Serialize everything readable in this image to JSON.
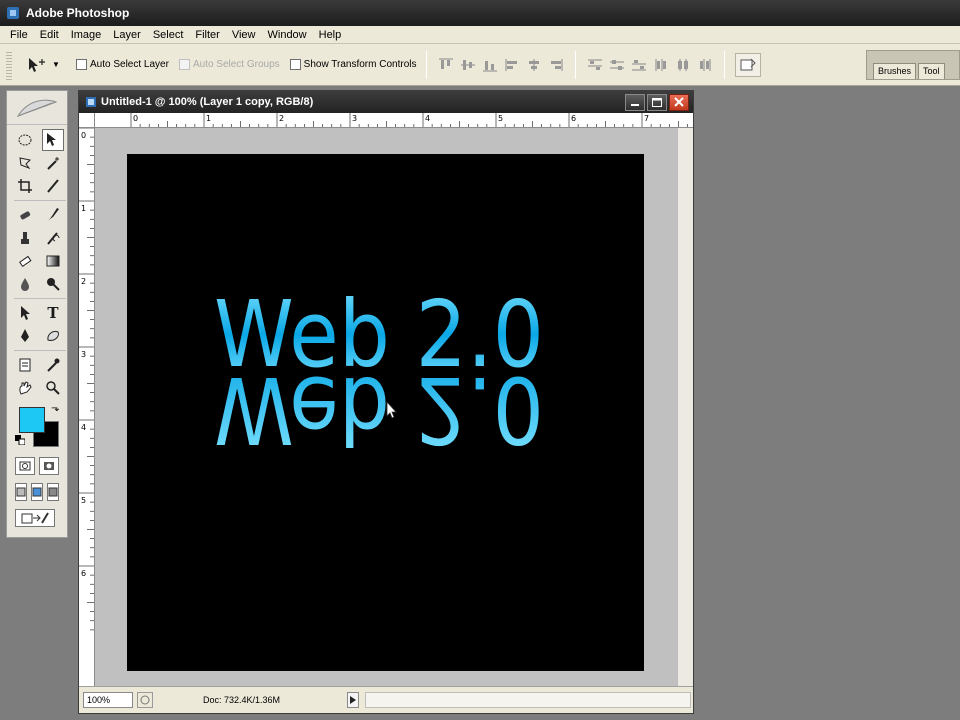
{
  "app": {
    "title": "Adobe Photoshop"
  },
  "menu": [
    "File",
    "Edit",
    "Image",
    "Layer",
    "Select",
    "Filter",
    "View",
    "Window",
    "Help"
  ],
  "options": {
    "auto_select_layer": "Auto Select Layer",
    "auto_select_groups": "Auto Select Groups",
    "show_transform_controls": "Show Transform Controls"
  },
  "palette_well": {
    "tabs": [
      "Brushes",
      "Tool"
    ]
  },
  "document": {
    "title": "Untitled-1 @ 100% (Layer 1 copy, RGB/8)",
    "zoom": "100%",
    "doc_info": "Doc: 732.4K/1.36M",
    "ruler_h_labels": [
      "0",
      "1",
      "2",
      "3",
      "4",
      "5",
      "6",
      "7"
    ],
    "ruler_v_labels": [
      "0",
      "1",
      "2",
      "3",
      "4",
      "5",
      "6"
    ]
  },
  "canvas": {
    "text": "Web 2.0",
    "reflection_text": "Web 2.0",
    "text_color_top": "#7fe3ff",
    "text_color_bottom": "#0aa8e6",
    "background": "#000000"
  },
  "colors": {
    "foreground": "#1ec8f5",
    "background": "#000000"
  }
}
